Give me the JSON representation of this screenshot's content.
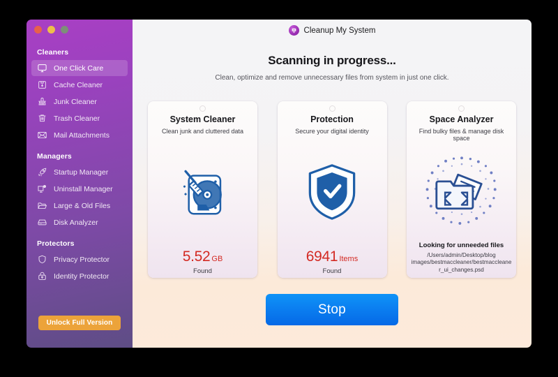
{
  "window": {
    "traffic_lights": [
      {
        "name": "close",
        "color": "#e8604c"
      },
      {
        "name": "minimize",
        "color": "#eebe4a"
      },
      {
        "name": "maximize",
        "color": "#7d8f78"
      }
    ]
  },
  "sidebar": {
    "groups": [
      {
        "title": "Cleaners",
        "items": [
          {
            "label": "One Click Care",
            "icon": "monitor-icon",
            "active": true
          },
          {
            "label": "Cache Cleaner",
            "icon": "cache-box-icon",
            "active": false
          },
          {
            "label": "Junk Cleaner",
            "icon": "broom-icon",
            "active": false
          },
          {
            "label": "Trash Cleaner",
            "icon": "trash-icon",
            "active": false
          },
          {
            "label": "Mail Attachments",
            "icon": "envelope-icon",
            "active": false
          }
        ]
      },
      {
        "title": "Managers",
        "items": [
          {
            "label": "Startup Manager",
            "icon": "rocket-icon",
            "active": false
          },
          {
            "label": "Uninstall Manager",
            "icon": "monitor-badge-icon",
            "active": false
          },
          {
            "label": "Large & Old Files",
            "icon": "folder-icon",
            "active": false
          },
          {
            "label": "Disk Analyzer",
            "icon": "disk-icon",
            "active": false
          }
        ]
      },
      {
        "title": "Protectors",
        "items": [
          {
            "label": "Privacy Protector",
            "icon": "shield-icon",
            "active": false
          },
          {
            "label": "Identity Protector",
            "icon": "lock-icon",
            "active": false
          }
        ]
      }
    ],
    "unlock_button": "Unlock Full Version",
    "accent_color": "#eca33a",
    "background_from": "#a93fc4",
    "background_to": "#5e4d85"
  },
  "main": {
    "brand_title": "Cleanup My System",
    "brand_logo_icon": "app-logo-icon",
    "headline": "Scanning in progress...",
    "subheadline": "Clean, optimize and remove unnecessary files from system in just one click.",
    "stop_button": "Stop",
    "stop_button_color": "#0b7ef0",
    "stat_color": "#d32a23",
    "cards": [
      {
        "title": "System Cleaner",
        "subtitle": "Clean junk and cluttered data",
        "icon": "disk-broom-icon",
        "stat_value": "5.52",
        "stat_unit": "GB",
        "stat_caption": "Found"
      },
      {
        "title": "Protection",
        "subtitle": "Secure your digital identity",
        "icon": "shield-check-icon",
        "stat_value": "6941",
        "stat_unit": "Items",
        "stat_caption": "Found"
      },
      {
        "title": "Space Analyzer",
        "subtitle": "Find bulky files & manage disk space",
        "icon": "folder-expand-icon",
        "scan_label": "Looking for unneeded files",
        "scan_path": "/Users/admin/Desktop/blog images/bestmaccleaner/bestmaccleaner_ui_changes.psd"
      }
    ]
  }
}
